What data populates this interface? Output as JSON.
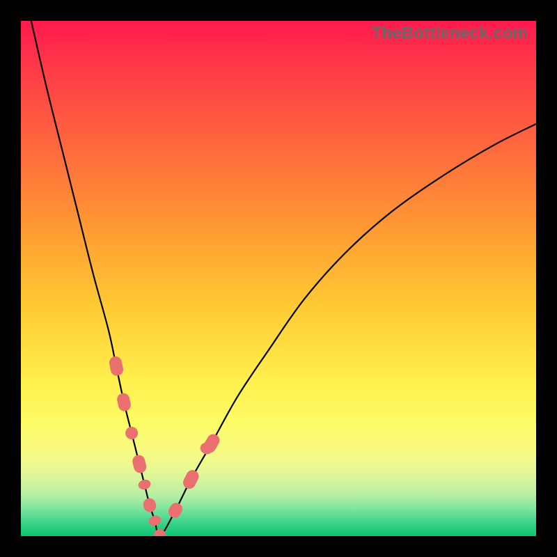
{
  "watermark": "TheBottleneck.com",
  "chart_data": {
    "type": "line",
    "title": "",
    "xlabel": "",
    "ylabel": "",
    "xlim": [
      0,
      100
    ],
    "ylim": [
      0,
      100
    ],
    "grid": false,
    "legend": false,
    "series": [
      {
        "name": "bottleneck-curve",
        "x": [
          2,
          5,
          8,
          11,
          14,
          17,
          18.5,
          20,
          21.5,
          23,
          24,
          25,
          26,
          27,
          30,
          33,
          37,
          42,
          48,
          55,
          63,
          72,
          82,
          92,
          100
        ],
        "values": [
          100,
          87,
          75,
          63,
          51,
          40,
          33,
          26,
          20,
          14,
          10,
          6,
          3,
          0,
          5,
          11,
          18,
          27,
          36,
          46,
          55,
          63,
          70,
          76,
          80
        ]
      }
    ],
    "markers": {
      "name": "highlighted-points",
      "color": "#e9706f",
      "points": [
        {
          "x": 18.5,
          "y": 33,
          "len": 28
        },
        {
          "x": 20.0,
          "y": 26,
          "len": 26
        },
        {
          "x": 21.5,
          "y": 20,
          "len": 18
        },
        {
          "x": 23.0,
          "y": 14,
          "len": 26
        },
        {
          "x": 24.0,
          "y": 10,
          "len": 14
        },
        {
          "x": 25.0,
          "y": 6,
          "len": 20
        },
        {
          "x": 26.0,
          "y": 3,
          "len": 14
        },
        {
          "x": 27.0,
          "y": 0,
          "len": 20
        },
        {
          "x": 30.0,
          "y": 5,
          "len": 22
        },
        {
          "x": 33.0,
          "y": 11,
          "len": 28
        },
        {
          "x": 36.0,
          "y": 17,
          "len": 16
        },
        {
          "x": 37.0,
          "y": 18,
          "len": 28
        }
      ]
    }
  }
}
